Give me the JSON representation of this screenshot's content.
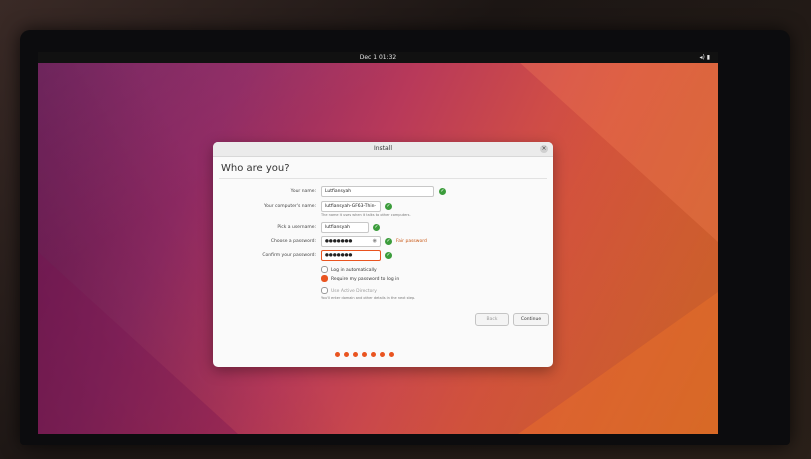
{
  "topbar": {
    "clock": "Dec 1 01:32",
    "tray": "◂) ▮"
  },
  "dialog": {
    "title": "Install",
    "close_glyph": "×",
    "heading": "Who are you?",
    "name": {
      "label": "Your name:",
      "value": "Lutfiansyah"
    },
    "computer": {
      "label": "Your computer's name:",
      "value": "lutfiansyah-GF63-Thin-",
      "hint": "The name it uses when it talks to other computers."
    },
    "username": {
      "label": "Pick a username:",
      "value": "lutfiansyah"
    },
    "password": {
      "label": "Choose a password:",
      "value": "●●●●●●●",
      "strength": "Fair password"
    },
    "confirm": {
      "label": "Confirm your password:",
      "value": "●●●●●●●"
    },
    "login_auto": "Log in automatically",
    "login_require": "Require my password to log in",
    "active_directory": "Use Active Directory",
    "ad_hint": "You'll enter domain and other details in the next step.",
    "back": "Back",
    "continue": "Continue"
  },
  "progress": {
    "steps": 7,
    "colors": {
      "dot": "#e95420"
    }
  }
}
